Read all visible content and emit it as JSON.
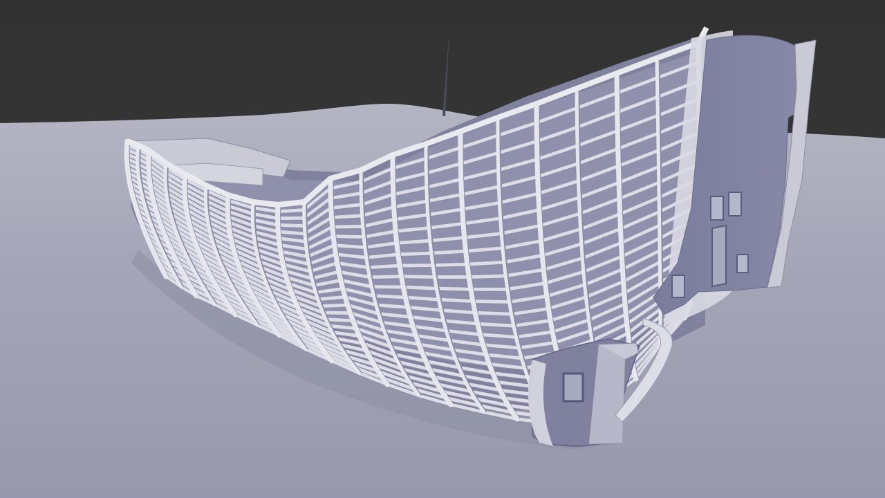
{
  "scene": {
    "type": "3d-render",
    "subject": "ship hull frame",
    "colors": {
      "sky": "#373737",
      "ground": "#9fa0b2",
      "ground_far": "#b3b4c2",
      "rib": "#dcdde6",
      "rib_shadow": "#8b8ca6",
      "transom": "#7e80a0",
      "transom_light": "#a6a8c2",
      "plank": "#b9bacb"
    }
  }
}
